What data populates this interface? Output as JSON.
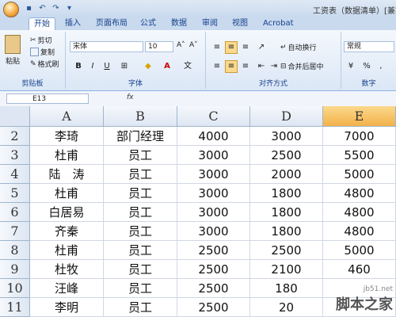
{
  "title_bar": {
    "title": "工资表（数据清单）[兼容"
  },
  "tabs": [
    "开始",
    "插入",
    "页面布局",
    "公式",
    "数据",
    "审阅",
    "视图",
    "Acrobat"
  ],
  "ribbon": {
    "clipboard": {
      "paste": "粘贴",
      "cut": "剪切",
      "copy": "复制",
      "format_painter": "格式刷",
      "label": "剪贴板"
    },
    "font": {
      "name": "宋体",
      "size": "10",
      "label": "字体"
    },
    "alignment": {
      "wrap": "自动换行",
      "merge": "合并后居中",
      "label": "对齐方式"
    },
    "number": {
      "format": "常规",
      "label": "数字"
    }
  },
  "formula_bar": {
    "name_box": "E13",
    "fx": "fx"
  },
  "columns": [
    "A",
    "B",
    "C",
    "D",
    "E"
  ],
  "selected_column": "E",
  "rows": [
    {
      "num": "2",
      "cells": [
        "李琦",
        "部门经理",
        "4000",
        "3000",
        "7000"
      ]
    },
    {
      "num": "3",
      "cells": [
        "杜甫",
        "员工",
        "3000",
        "2500",
        "5500"
      ]
    },
    {
      "num": "4",
      "cells": [
        "陆　涛",
        "员工",
        "3000",
        "2000",
        "5000"
      ]
    },
    {
      "num": "5",
      "cells": [
        "杜甫",
        "员工",
        "3000",
        "1800",
        "4800"
      ]
    },
    {
      "num": "6",
      "cells": [
        "白居易",
        "员工",
        "3000",
        "1800",
        "4800"
      ]
    },
    {
      "num": "7",
      "cells": [
        "齐秦",
        "员工",
        "3000",
        "1800",
        "4800"
      ]
    },
    {
      "num": "8",
      "cells": [
        "杜甫",
        "员工",
        "2500",
        "2500",
        "5000"
      ]
    },
    {
      "num": "9",
      "cells": [
        "杜牧",
        "员工",
        "2500",
        "2100",
        "460"
      ]
    },
    {
      "num": "10",
      "cells": [
        "汪峰",
        "员工",
        "2500",
        "180",
        ""
      ]
    },
    {
      "num": "11",
      "cells": [
        "李明",
        "员工",
        "2500",
        "20",
        ""
      ]
    }
  ],
  "watermark": {
    "url": "jb51.net",
    "text": "脚本之家"
  }
}
